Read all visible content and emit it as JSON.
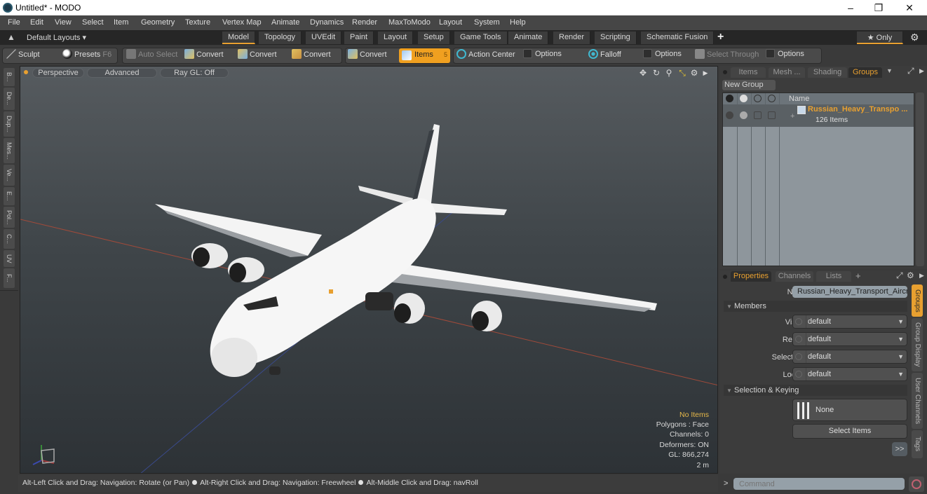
{
  "window": {
    "title": "Untitled* - MODO",
    "minimize_icon": "minimize-icon",
    "maximize_icon": "restore-icon",
    "close_icon": "close-icon"
  },
  "menubar": {
    "items": [
      "File",
      "Edit",
      "View",
      "Select",
      "Item",
      "Geometry",
      "Texture",
      "Vertex Map",
      "Animate",
      "Dynamics",
      "Render",
      "MaxToModo",
      "Layout",
      "System",
      "Help"
    ]
  },
  "layoutbar": {
    "layouts_label": "Default Layouts ▾",
    "tabs": [
      "Model",
      "Topology",
      "UVEdit",
      "Paint",
      "Layout",
      "Setup",
      "Game Tools",
      "Animate",
      "Render",
      "Scripting",
      "Schematic Fusion"
    ],
    "active_tab": "Model",
    "add_label": "+",
    "only_label": "★ Only",
    "star_color": "#e8c830",
    "accent_color": "#e8a030"
  },
  "toolbar": {
    "sculpt": "Sculpt",
    "presets": "Presets",
    "presets_key": "F6",
    "auto_select": "Auto Select",
    "convert1": "Convert",
    "convert2": "Convert",
    "convert3": "Convert",
    "convert4": "Convert",
    "items": "Items",
    "items_key": "5",
    "action_center": "Action Center",
    "options1": "Options",
    "falloff": "Falloff",
    "options2": "Options",
    "select_through": "Select Through",
    "options3": "Options"
  },
  "lefttabs": [
    "B...",
    "De...",
    "Dup...",
    "Mes...",
    "Ve...",
    "E...",
    "Pol...",
    "C...",
    "UV",
    "F..."
  ],
  "viewport": {
    "perspective": "Perspective",
    "advanced": "Advanced",
    "raygl": "Ray GL: Off",
    "hud": {
      "selection": "No Items",
      "polygons": "Polygons : Face",
      "channels": "Channels: 0",
      "deformers": "Deformers: ON",
      "gl": "GL: 866,274",
      "scale": "2 m"
    },
    "background_color": "#3f4549"
  },
  "statusbar": {
    "hint1": "Alt-Left Click and Drag: Navigation: Rotate (or Pan)",
    "hint2": "Alt-Right Click and Drag: Navigation: Freewheel",
    "hint3": "Alt-Middle Click and Drag: navRoll"
  },
  "groups_panel": {
    "tabs": [
      "Items",
      "Mesh ...",
      "Shading",
      "Groups"
    ],
    "active_tab": "Groups",
    "new_group": "New Group",
    "column_name": "Name",
    "group_name": "Russian_Heavy_Transpo ...",
    "group_count": "126 Items",
    "group_color": "#e8a030"
  },
  "properties_panel": {
    "tabs": [
      "Properties",
      "Channels",
      "Lists"
    ],
    "add_label": "+",
    "active_tab": "Properties",
    "name_label": "Name",
    "name_value": "Russian_Heavy_Transport_Aircra",
    "members_section": "Members",
    "fields": [
      {
        "label": "Visible",
        "value": "default"
      },
      {
        "label": "Render",
        "value": "default"
      },
      {
        "label": "Selectable",
        "value": "default"
      },
      {
        "label": "Locked",
        "value": "default"
      }
    ],
    "selection_section": "Selection & Keying",
    "none_label": "None",
    "select_items": "Select Items",
    "more_label": ">>",
    "side_tabs": [
      "Groups",
      "Group Display",
      "User Channels",
      "Tags"
    ]
  },
  "command": {
    "prompt": ">",
    "placeholder": "Command"
  }
}
